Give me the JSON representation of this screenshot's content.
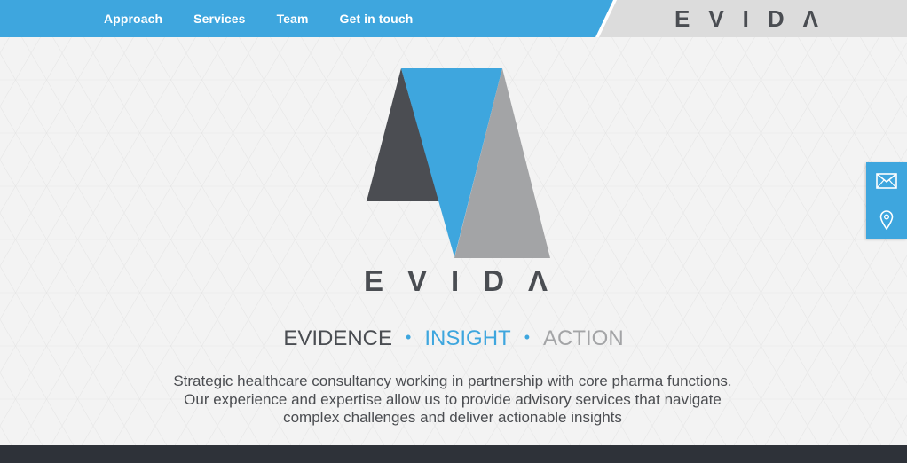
{
  "nav": {
    "links": [
      {
        "label": "Approach"
      },
      {
        "label": "Services"
      },
      {
        "label": "Team"
      },
      {
        "label": "Get in touch"
      }
    ],
    "logo_text": "EVIDΛ"
  },
  "hero": {
    "wordmark": "EVIDΛ",
    "tagline": {
      "word1": "EVIDENCE",
      "word2": "INSIGHT",
      "word3": "ACTION",
      "separator": "•"
    },
    "description": [
      "Strategic healthcare consultancy working in partnership with core pharma functions.",
      "Our experience and expertise allow us to provide advisory services that navigate",
      "complex challenges and deliver actionable insights"
    ]
  },
  "side_widget": {
    "buttons": [
      {
        "icon": "envelope-icon"
      },
      {
        "icon": "map-pin-icon"
      }
    ]
  },
  "colors": {
    "brand_blue": "#3ea6de",
    "dark_grey": "#4a4d52",
    "light_grey": "#a3a4a6",
    "header_grey": "#dcdcdc",
    "footer": "#2e3239"
  }
}
